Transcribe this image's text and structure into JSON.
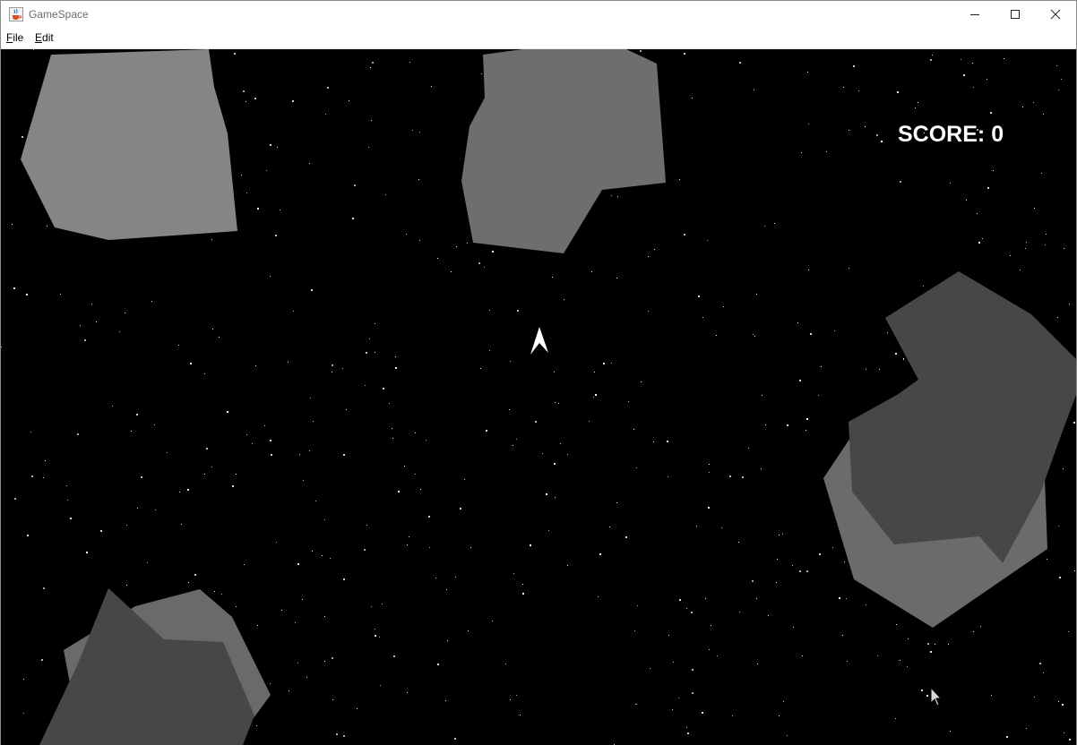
{
  "window": {
    "title": "GameSpace",
    "app_icon": "java-cup-icon",
    "controls": {
      "minimize_icon": "minimize-icon",
      "maximize_icon": "maximize-icon",
      "close_icon": "close-icon"
    }
  },
  "menubar": {
    "items": [
      {
        "label": "File",
        "mnemonic": "F",
        "rest": "ile"
      },
      {
        "label": "Edit",
        "mnemonic": "E",
        "rest": "dit"
      }
    ]
  },
  "game": {
    "score_label": "SCORE:",
    "score_value": "0",
    "background_color": "#000000",
    "ship_color": "#ffffff",
    "asteroid_colors": {
      "light": "#858585",
      "medium": "#6e6e6e",
      "dark": "#474747"
    }
  }
}
